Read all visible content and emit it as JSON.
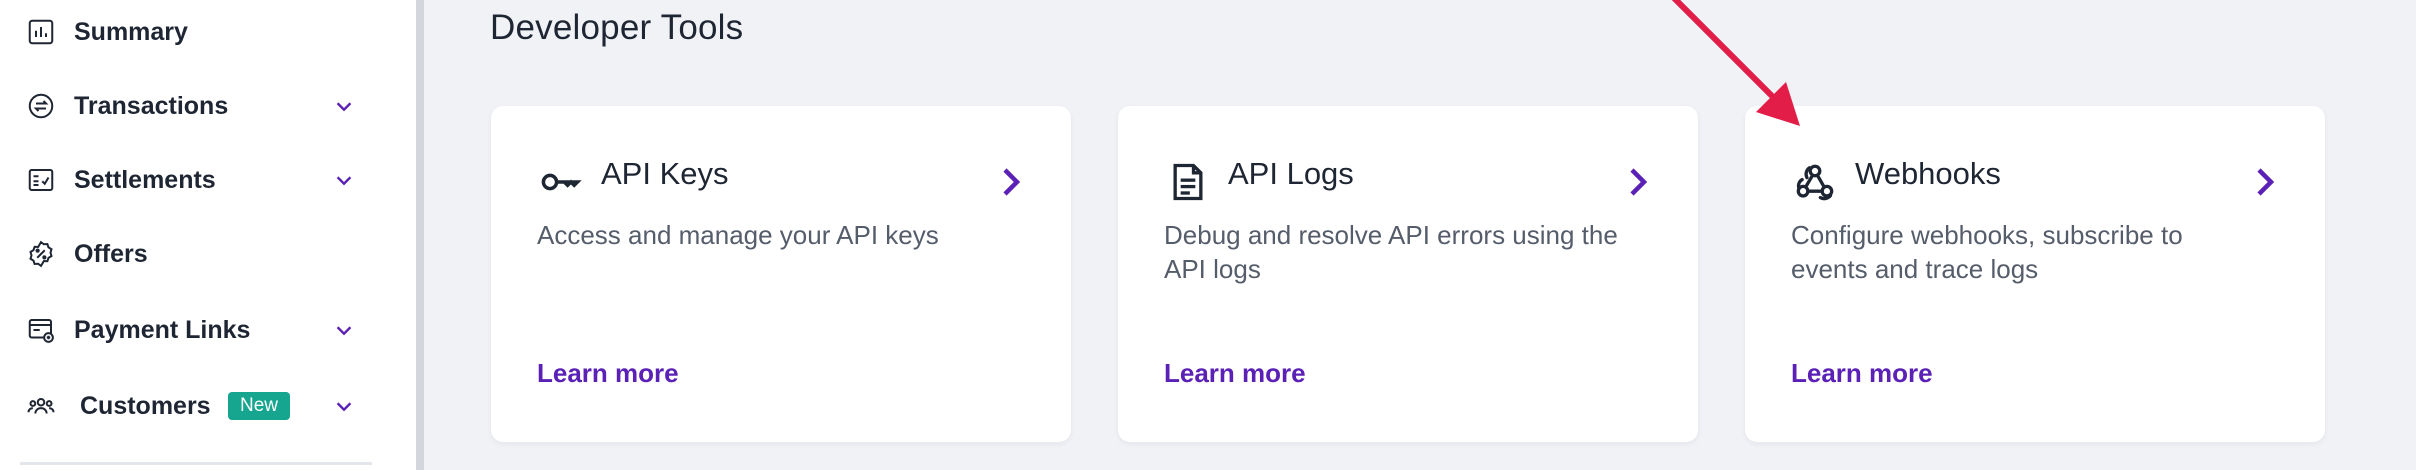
{
  "sidebar": {
    "items": [
      {
        "label": "Summary",
        "icon": "bar-chart-icon",
        "has_chevron": false
      },
      {
        "label": "Transactions",
        "icon": "transactions-icon",
        "has_chevron": true
      },
      {
        "label": "Settlements",
        "icon": "settlements-icon",
        "has_chevron": true
      },
      {
        "label": "Offers",
        "icon": "offer-badge-icon",
        "has_chevron": false
      },
      {
        "label": "Payment Links",
        "icon": "payment-link-icon",
        "has_chevron": true
      },
      {
        "label": "Customers",
        "icon": "customers-icon",
        "has_chevron": true,
        "badge": "New"
      }
    ]
  },
  "main": {
    "title": "Developer Tools",
    "cards": [
      {
        "title": "API Keys",
        "icon": "key-icon",
        "description": "Access and manage your API keys",
        "link": "Learn more"
      },
      {
        "title": "API Logs",
        "icon": "document-icon",
        "description": "Debug and resolve API errors using the API logs",
        "link": "Learn more"
      },
      {
        "title": "Webhooks",
        "icon": "webhook-icon",
        "description": "Configure webhooks, subscribe to events and trace logs",
        "link": "Learn more"
      }
    ]
  },
  "colors": {
    "accent": "#5b21b6",
    "badge": "#16a58f",
    "annotation_arrow": "#e11d48",
    "background": "#f0f2f6"
  }
}
